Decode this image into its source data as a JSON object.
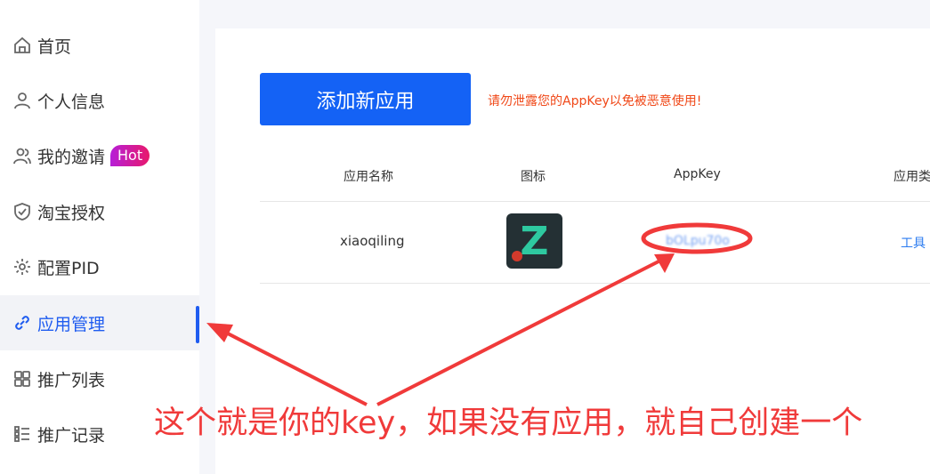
{
  "sidebar": {
    "items": [
      {
        "label": "首页"
      },
      {
        "label": "个人信息"
      },
      {
        "label": "我的邀请",
        "badge": "Hot"
      },
      {
        "label": "淘宝授权"
      },
      {
        "label": "配置PID"
      },
      {
        "label": "应用管理",
        "active": true
      },
      {
        "label": "推广列表"
      },
      {
        "label": "推广记录"
      }
    ]
  },
  "main": {
    "add_button_label": "添加新应用",
    "warning": "请勿泄露您的AppKey以免被恶意使用!",
    "table": {
      "headers": [
        "应用名称",
        "图标",
        "AppKey",
        "应用类"
      ],
      "rows": [
        {
          "name": "xiaoqiling",
          "icon_letter": "Z",
          "appkey": "bOLpu70o",
          "type": "工具"
        }
      ]
    }
  },
  "annotation": {
    "text": "这个就是你的key，如果没有应用，就自己创建一个"
  },
  "colors": {
    "accent": "#1f5cf0",
    "button": "#1462f5",
    "warning": "#f04818",
    "annotation": "#f03a3a",
    "hot_badge_from": "#b61fd8",
    "hot_badge_to": "#e8196b",
    "icon_bg": "#243034",
    "icon_letter": "#2ec9a0"
  }
}
